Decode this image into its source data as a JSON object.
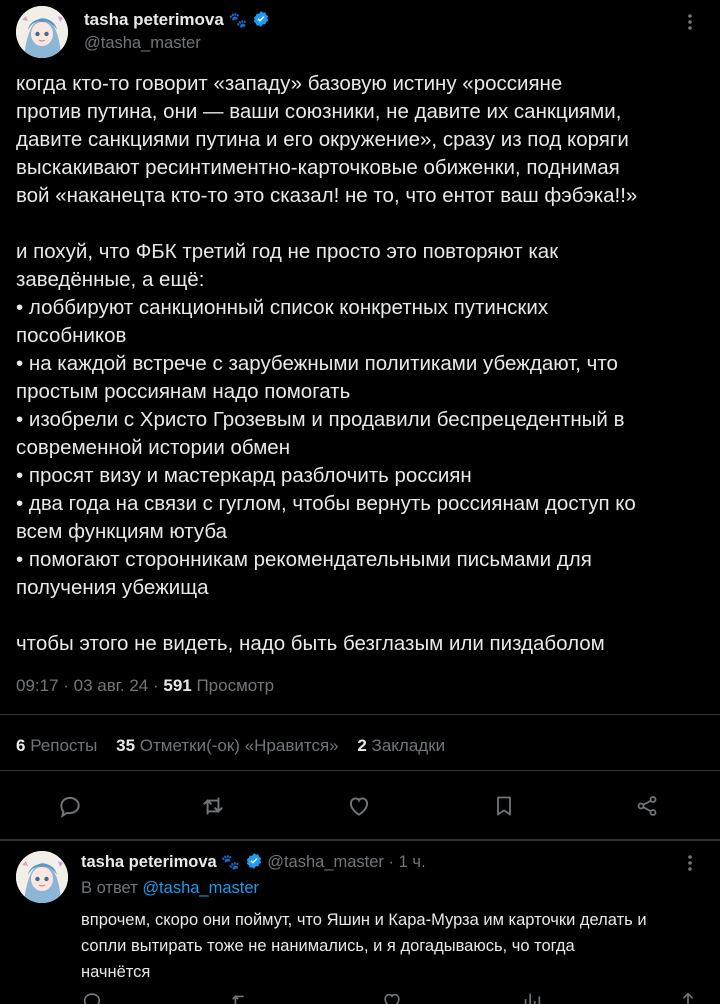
{
  "post": {
    "author_name": "tasha peterimova",
    "author_handle": "@tasha_master",
    "badge_emoji": "🐾",
    "text": "когда кто-то говорит «западу» базовую истину «россияне\nпротив путина, они — ваши союзники, не давите их санкциями,\nдавите санкциями путина и его окружение», сразу из под коряги\nвыскакивают ресинтиментно-карточковые обиженки, поднимая\nвой «наканецта кто-то это сказал! не то, что ентот ваш фэбэка!!»\n\nи похуй, что ФБК третий год не просто это повторяют как\nзаведённые, а ещё:\n• лоббируют санкционный список конкретных путинских\nпособников\n• на каждой встрече с зарубежными политиками убеждают, что\nпростым россиянам надо помогать\n• изобрели с Христо Грозевым и продавили беспрецедентный в\nсовременной истории обмен\n• просят визу и мастеркард разблочить россиян\n• два года на связи с гуглом, чтобы вернуть россиянам доступ ко\nвсем функциям ютуба\n• помогают сторонникам рекомендательными письмами для\nполучения убежища\n\nчтобы этого не видеть, надо быть безглазым или пиздаболом",
    "time_date": "09:17 · 03 авг. 24 · ",
    "views_count": "591",
    "views_label": " Просмотр",
    "reposts_count": "6",
    "reposts_label": " Репосты",
    "likes_count": "35",
    "likes_label": " Отметки(-ок) «Нравится»",
    "bookmarks_count": "2",
    "bookmarks_label": " Закладки"
  },
  "reply": {
    "author_name": "tasha peterimova",
    "badge_emoji": "🐾",
    "handle_time": "@tasha_master · 1 ч.",
    "reply_prefix": "В ответ ",
    "reply_to": "@tasha_master",
    "text": "впрочем, скоро они поймут, что Яшин и Кара-Мурза им карточки делать и\nсопли вытирать тоже не нанимались, и я догадываюсь, чо тогда\nначнётся"
  },
  "colors": {
    "background": "#000000",
    "text": "#e7e9ea",
    "muted": "#71767b",
    "accent": "#1d9bf0",
    "divider": "#2f3336"
  },
  "icons": [
    "more-icon",
    "reply-icon",
    "retweet-icon",
    "like-icon",
    "bookmark-icon",
    "share-icon",
    "verified-icon",
    "avatar"
  ]
}
